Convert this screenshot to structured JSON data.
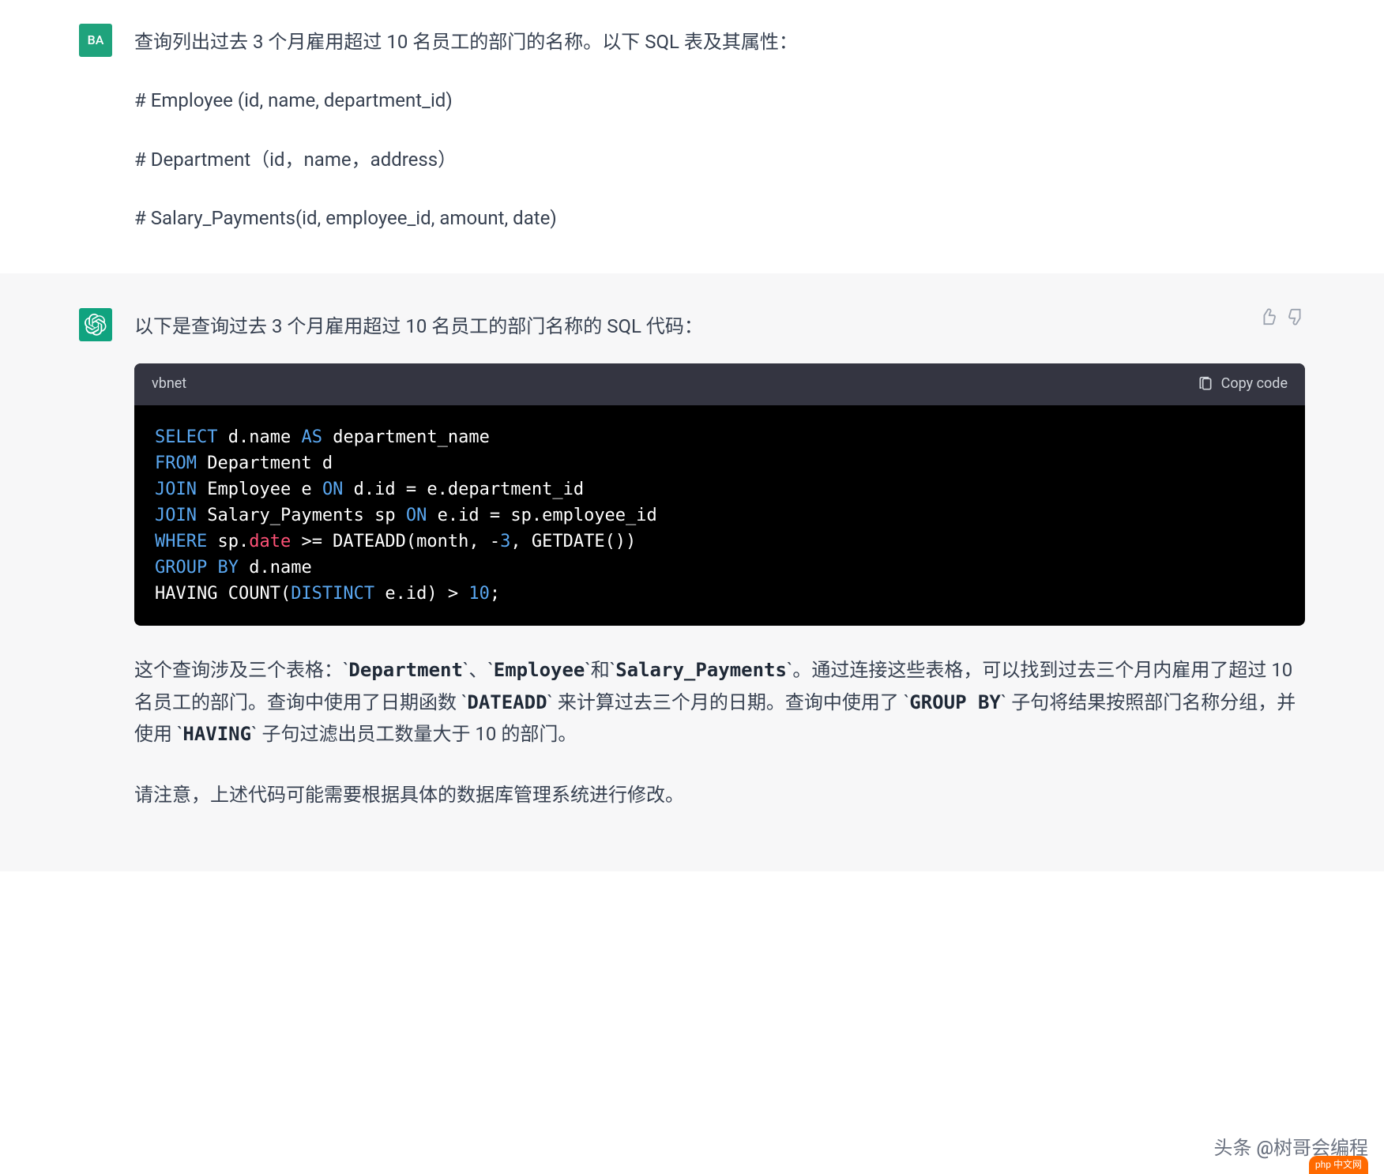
{
  "user": {
    "avatar_text": "BA",
    "line1": "查询列出过去 3 个月雇用超过 10 名员工的部门的名称。以下 SQL 表及其属性：",
    "line2": "# Employee (id, name, department_id)",
    "line3": "# Department（id，name，address）",
    "line4": "# Salary_Payments(id, employee_id, amount, date)"
  },
  "assistant": {
    "intro": "以下是查询过去 3 个月雇用超过 10 名员工的部门名称的 SQL 代码：",
    "code_lang": "vbnet",
    "copy_label": "Copy code",
    "code": {
      "l1_select": "SELECT",
      "l1_rest1": " d.name ",
      "l1_as": "AS",
      "l1_rest2": " department_name",
      "l2_from": "FROM",
      "l2_rest": " Department d",
      "l3_join": "JOIN",
      "l3_rest1": " Employee e ",
      "l3_on": "ON",
      "l3_rest2": " d.id = e.department_id",
      "l4_join": "JOIN",
      "l4_rest1": " Salary_Payments sp ",
      "l4_on": "ON",
      "l4_rest2": " e.id = sp.employee_id",
      "l5_where": "WHERE",
      "l5_rest1": " sp.",
      "l5_date": "date",
      "l5_rest2": " >= DATEADD(month, -",
      "l5_num3": "3",
      "l5_rest3": ", GETDATE())",
      "l6_group": "GROUP",
      "l6_by": " BY",
      "l6_rest": " d.name",
      "l7_rest1": "HAVING COUNT(",
      "l7_distinct": "DISTINCT",
      "l7_rest2": " e.id) > ",
      "l7_num10": "10",
      "l7_rest3": ";"
    },
    "explanation1_pre": "这个查询涉及三个表格：`",
    "explanation1_c1": "Department",
    "explanation1_mid1": "`、`",
    "explanation1_c2": "Employee",
    "explanation1_mid2": "`和`",
    "explanation1_c3": "Salary_Payments",
    "explanation1_mid3": "`。通过连接这些表格，可以找到过去三个月内雇用了超过 10 名员工的部门。查询中使用了日期函数 `",
    "explanation1_c4": "DATEADD",
    "explanation1_mid4": "` 来计算过去三个月的日期。查询中使用了 `",
    "explanation1_c5": "GROUP BY",
    "explanation1_mid5": "` 子句将结果按照部门名称分组，并使用 `",
    "explanation1_c6": "HAVING",
    "explanation1_end": "` 子句过滤出员工数量大于 10 的部门。",
    "explanation2": "请注意，上述代码可能需要根据具体的数据库管理系统进行修改。"
  },
  "watermark": {
    "text": "头条 @树哥会编程",
    "badge": "php 中文网"
  }
}
